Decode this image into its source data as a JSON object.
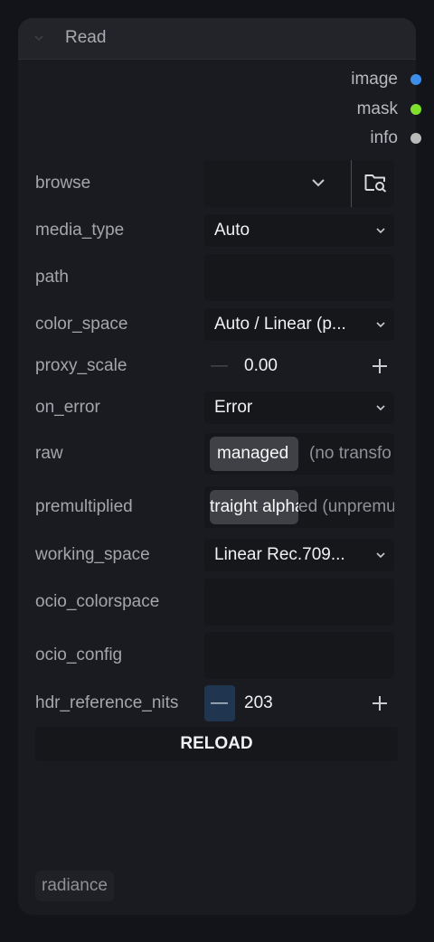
{
  "node": {
    "title": "Read",
    "outputs": [
      {
        "label": "image",
        "color": "#3b8eea"
      },
      {
        "label": "mask",
        "color": "#7ee02b"
      },
      {
        "label": "info",
        "color": "#b9b9b9"
      }
    ],
    "widgets": {
      "browse": {
        "label": "browse",
        "icons": [
          "chevron-down-icon",
          "folder-search-icon"
        ]
      },
      "media_type": {
        "label": "media_type",
        "value": "Auto"
      },
      "path": {
        "label": "path",
        "value": ""
      },
      "color_space": {
        "label": "color_space",
        "value": "Auto / Linear (p..."
      },
      "proxy_scale": {
        "label": "proxy_scale",
        "value": "0.00",
        "minus": "—",
        "plus": "+"
      },
      "on_error": {
        "label": "on_error",
        "value": "Error"
      },
      "raw": {
        "label": "raw",
        "active": "managed",
        "inactive": "(no transfo"
      },
      "premultiplied": {
        "label": "premultiplied",
        "active": "traight alpha",
        "inactive": "ed (unpremu"
      },
      "working_space": {
        "label": "working_space",
        "value": "Linear Rec.709..."
      },
      "ocio_colorspace": {
        "label": "ocio_colorspace",
        "value": ""
      },
      "ocio_config": {
        "label": "ocio_config",
        "value": ""
      },
      "hdr_reference_nits": {
        "label": "hdr_reference_nits",
        "value": "203",
        "minus": "—",
        "plus": "+"
      }
    },
    "reload_label": "RELOAD",
    "footer_tag": "radiance"
  }
}
